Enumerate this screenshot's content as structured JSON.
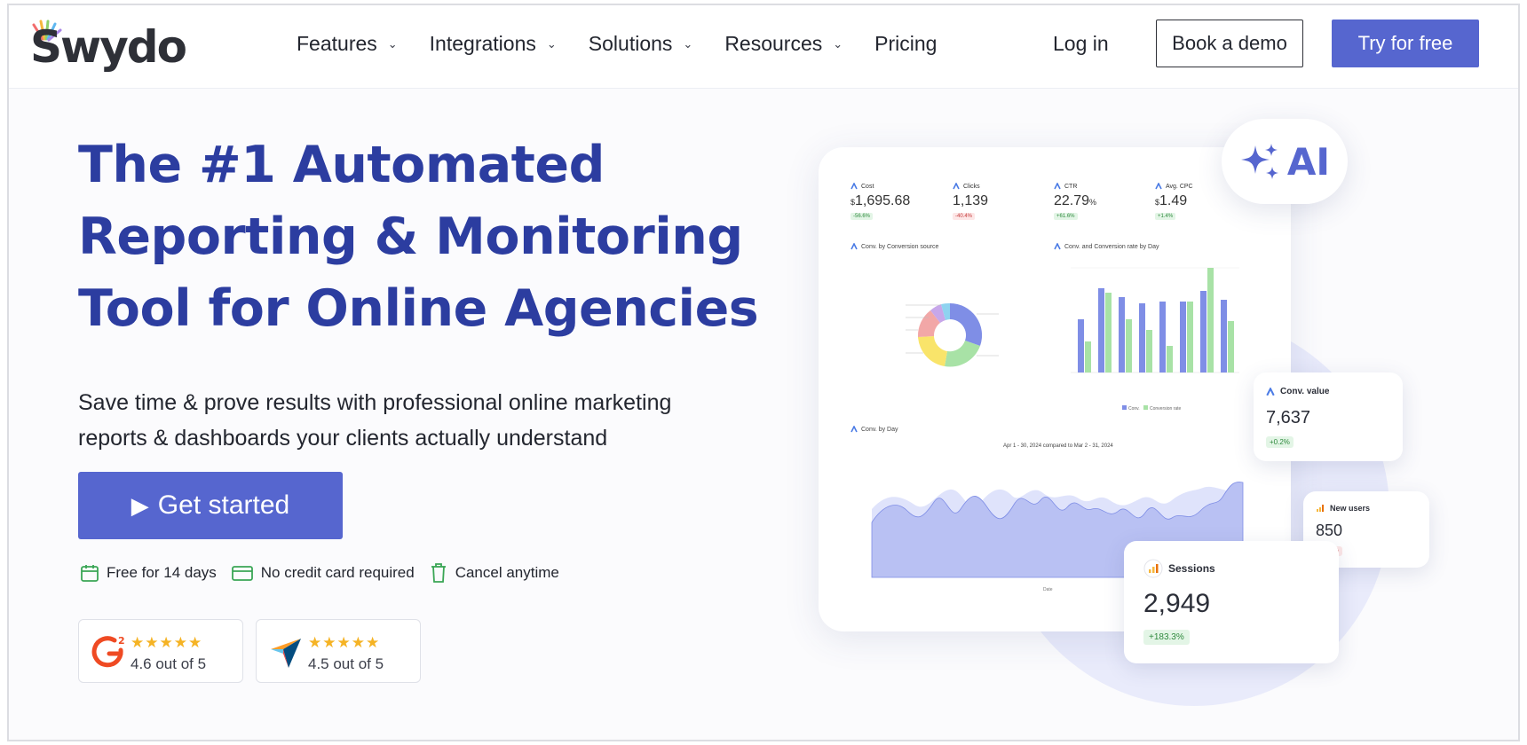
{
  "brand": {
    "name": "Swydo",
    "accent": "#5666cf",
    "headline_color": "#2c3da0"
  },
  "nav": {
    "items": [
      {
        "label": "Features",
        "has_dropdown": true
      },
      {
        "label": "Integrations",
        "has_dropdown": true
      },
      {
        "label": "Solutions",
        "has_dropdown": true
      },
      {
        "label": "Resources",
        "has_dropdown": true
      },
      {
        "label": "Pricing",
        "has_dropdown": false
      }
    ],
    "login": "Log in",
    "book_demo": "Book a demo",
    "try_free": "Try for free"
  },
  "hero": {
    "title_lines": [
      "The #1 Automated",
      "Reporting & Monitoring",
      "Tool for Online Agencies"
    ],
    "subtitle_lines": [
      "Save time & prove results with professional online marketing",
      "reports & dashboards your clients actually understand"
    ],
    "cta": "Get started",
    "perks": [
      "Free for 14 days",
      "No credit card required",
      "Cancel anytime"
    ],
    "ratings": [
      {
        "source": "g2-logo-icon",
        "stars": 5,
        "text": "4.6 out of 5"
      },
      {
        "source": "capterra-logo-icon",
        "stars": 5,
        "text": "4.5 out of 5"
      }
    ]
  },
  "dashboard": {
    "ai_badge": "AI",
    "kpis": [
      {
        "label": "Cost",
        "prefix": "$",
        "value": "1,695.68",
        "change": "-56.6%",
        "trend": "down-green"
      },
      {
        "label": "Clicks",
        "prefix": "",
        "value": "1,139",
        "change": "-40.4%",
        "trend": "down-red"
      },
      {
        "label": "CTR",
        "prefix": "",
        "value": "22.79",
        "suffix": "%",
        "change": "+61.6%",
        "trend": "up"
      },
      {
        "label": "Avg. CPC",
        "prefix": "$",
        "value": "1.49",
        "change": "+1.4%",
        "trend": "up"
      }
    ],
    "donut_title": "Conv. by Conversion source",
    "bar_title": "Conv. and Conversion rate by Day",
    "bar_legend": [
      "Conv.",
      "Conversion rate"
    ],
    "area_title": "Conv. by Day",
    "area_subtitle": "Apr 1 - 30, 2024 compared to Mar 2 - 31, 2024",
    "area_legend": "Date",
    "conv_value": {
      "title": "Conv. value",
      "value": "7,637",
      "change": "+0.2%"
    },
    "new_users": {
      "title": "New users",
      "value": "850",
      "change": "-57.6%"
    },
    "sessions": {
      "title": "Sessions",
      "value": "2,949",
      "change": "+183.3%"
    }
  }
}
